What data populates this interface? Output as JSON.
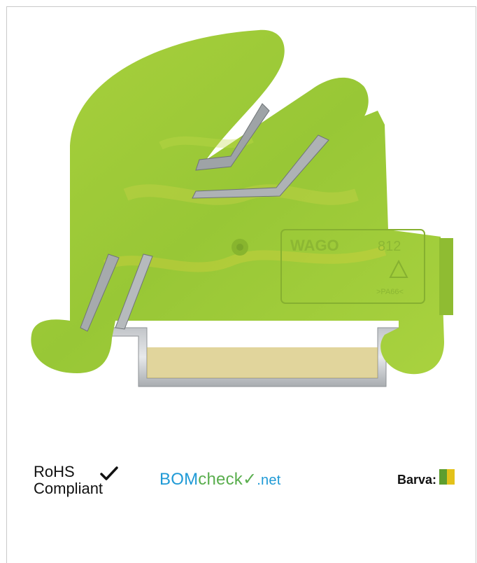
{
  "product": {
    "image_alt": "Ground terminal block",
    "brand_mark": "WAGO",
    "part_number": "812",
    "material_mark": ">PA66<",
    "colors": {
      "body": "#9cc93a",
      "body_light": "#b6dc4e",
      "marbling": "#d7d43c",
      "rail": "#b0b4b8"
    }
  },
  "footer": {
    "rohs_line1": "RoHS",
    "rohs_line2": "Compliant",
    "rohs_check_icon": "checkmark-icon",
    "bomcheck_bom": "BOM",
    "bomcheck_check": "check",
    "bomcheck_net": ".net",
    "color_label": "Barva:",
    "color_swatch": [
      "#5e9e2f",
      "#e3c21a"
    ]
  }
}
